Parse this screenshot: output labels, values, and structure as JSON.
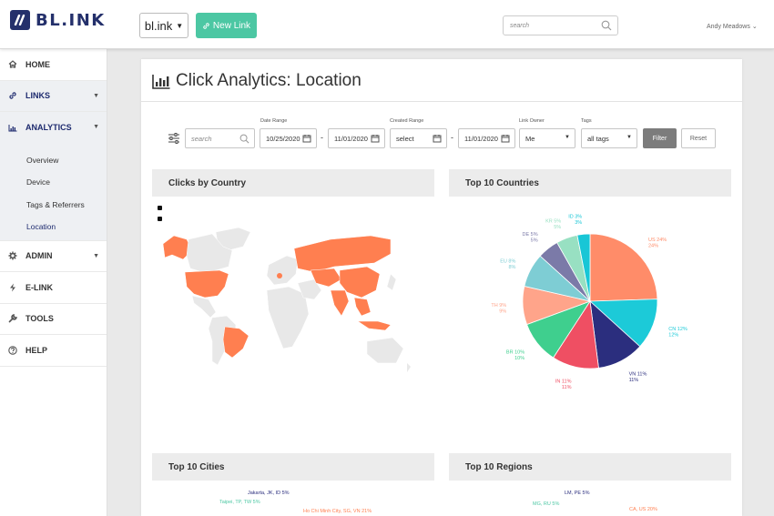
{
  "header": {
    "logo_text": "BL.INK",
    "domain": "bl.ink",
    "new_link": "New Link",
    "search_placeholder": "search",
    "user": "Andy Meadows"
  },
  "sidebar": {
    "items": [
      {
        "label": "HOME",
        "icon": "home-icon"
      },
      {
        "label": "LINKS",
        "icon": "link-icon"
      },
      {
        "label": "ANALYTICS",
        "icon": "chart-icon"
      },
      {
        "label": "ADMIN",
        "icon": "gear-icon"
      },
      {
        "label": "E-LINK",
        "icon": "bolt-icon"
      },
      {
        "label": "TOOLS",
        "icon": "wrench-icon"
      },
      {
        "label": "HELP",
        "icon": "help-icon"
      }
    ],
    "analytics_sub": [
      "Overview",
      "Device",
      "Tags & Referrers",
      "Location"
    ]
  },
  "page": {
    "title": "Click Analytics: Location"
  },
  "filters": {
    "search_placeholder": "search",
    "date_range_label": "Date Range",
    "date_from": "10/25/2020",
    "date_to": "11/01/2020",
    "created_range_label": "Created Range",
    "created_from": "select",
    "created_to": "11/01/2020",
    "owner_label": "Link Owner",
    "owner": "Me",
    "tags_label": "Tags",
    "tags": "all tags",
    "filter_btn": "Filter",
    "reset_btn": "Reset"
  },
  "panels": {
    "clicks_by_country": "Clicks by Country",
    "top_countries": "Top 10 Countries",
    "top_cities": "Top 10 Cities",
    "top_regions": "Top 10 Regions"
  },
  "cities_partial": [
    "Jakarta, JK, ID 5%",
    "Taipei, TP, TW 5%",
    "Ho Chi Minh City, SG, VN 21%"
  ],
  "regions_partial": [
    "LM, PE 5%",
    "MG, RU 5%",
    "CA, US 20%"
  ],
  "colors": {
    "accent": "#4cc7a3",
    "brand": "#24306b",
    "map_highlight": "#ff7f50"
  },
  "chart_data": {
    "type": "pie",
    "title": "Top 10 Countries",
    "slices": [
      {
        "label": "US",
        "value": 24,
        "color": "#ff8c69"
      },
      {
        "label": "CN",
        "value": 12,
        "color": "#1ccad8"
      },
      {
        "label": "VN",
        "value": 11,
        "color": "#2b2e7e"
      },
      {
        "label": "IN",
        "value": 11,
        "color": "#ef4f63"
      },
      {
        "label": "BR",
        "value": 10,
        "color": "#3fcf8e"
      },
      {
        "label": "TH",
        "value": 9,
        "color": "#ffa48a"
      },
      {
        "label": "EU",
        "value": 8,
        "color": "#7ecdd4"
      },
      {
        "label": "DE",
        "value": 5,
        "color": "#7b7aa8"
      },
      {
        "label": "KR",
        "value": 5,
        "color": "#98e0c2"
      },
      {
        "label": "ID",
        "value": 3,
        "color": "#18c6d6"
      }
    ]
  }
}
